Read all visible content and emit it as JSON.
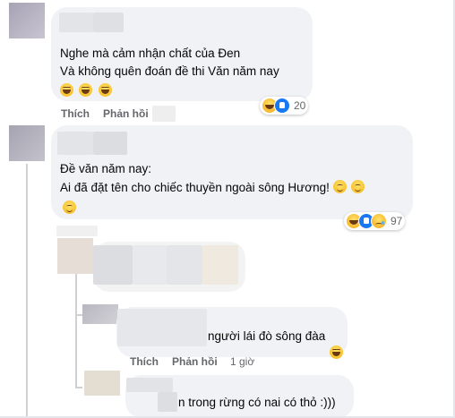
{
  "comments": [
    {
      "lines": [
        "Nghe mà cảm nhận chất của Đen",
        "Và không quên đoán đề thi Văn năm nay"
      ],
      "emojis": [
        "laugh",
        "laugh",
        "laugh"
      ],
      "reactions": {
        "icons": [
          "haha-icon",
          "like-icon"
        ],
        "count": "20"
      },
      "actions": {
        "like": "Thích",
        "reply": "Phản hồi"
      }
    },
    {
      "lines": [
        "Đề văn năm nay:",
        "Ai đã đặt tên cho chiếc thuyền ngoài sông Hương!"
      ],
      "emojis_inline": [
        "blush",
        "blush"
      ],
      "emojis_next_line": [
        "blush"
      ],
      "reactions": {
        "icons": [
          "haha-icon",
          "like-icon",
          "sad-icon"
        ],
        "count": "97"
      }
    }
  ],
  "replies": [
    {
      "text": "người lái đò sông đàa",
      "emojis": [
        "laugh"
      ],
      "actions": {
        "like": "Thích",
        "reply": "Phản hồi"
      },
      "time": "1 giờ"
    },
    {
      "text": "n trong rừng có nai có thỏ :)))"
    }
  ],
  "colors": {
    "bubble": "#f0f2f5",
    "muted_text": "#65676b",
    "like_blue": "#1877f2"
  }
}
